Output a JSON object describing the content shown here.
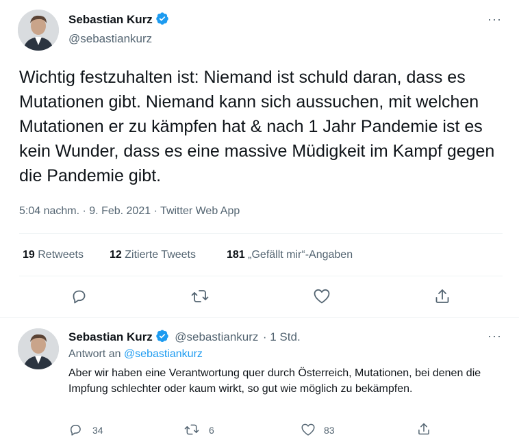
{
  "main_tweet": {
    "author_name": "Sebastian Kurz",
    "author_handle": "@sebastiankurz",
    "more_label": "···",
    "text": "Wichtig festzuhalten ist: Niemand ist schuld daran, dass es Mutationen gibt. Niemand kann sich aussuchen, mit welchen Mutationen er zu kämpfen hat & nach 1 Jahr Pandemie ist es kein Wunder, dass es eine massive Müdigkeit im Kampf gegen die Pandemie gibt.",
    "meta": "5:04 nachm. · 9. Feb. 2021 · Twitter Web App",
    "stats": {
      "retweets_count": "19",
      "retweets_label": "Retweets",
      "quotes_count": "12",
      "quotes_label": "Zitierte Tweets",
      "likes_count": "181",
      "likes_label": "„Gefällt mir“-Angaben"
    }
  },
  "reply_tweet": {
    "author_name": "Sebastian Kurz",
    "author_handle": "@sebastiankurz",
    "time": "· 1 Std.",
    "more_label": "···",
    "reply_to_prefix": "Antwort an",
    "reply_to_handle": "@sebastiankurz",
    "text": "Aber wir haben eine Verantwortung quer durch Österreich, Mutationen, bei denen die Impfung schlechter oder kaum wirkt, so gut wie möglich zu bekämpfen.",
    "reply_count": "34",
    "retweet_count": "6",
    "like_count": "83"
  },
  "colors": {
    "accent": "#1d9bf0",
    "secondary_text": "#536471",
    "divider": "#eff3f4"
  },
  "icons": [
    "verified-badge-icon",
    "reply-icon",
    "retweet-icon",
    "like-icon",
    "share-icon",
    "more-icon"
  ]
}
